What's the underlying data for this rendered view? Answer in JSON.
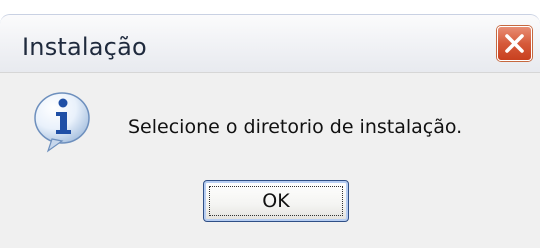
{
  "window": {
    "title": "Instalação",
    "close_icon": "close-icon",
    "accent_close": "#d65a3a"
  },
  "dialog": {
    "icon": "info-icon",
    "message": "Selecione o diretorio de instalação.",
    "ok_label": "OK"
  }
}
